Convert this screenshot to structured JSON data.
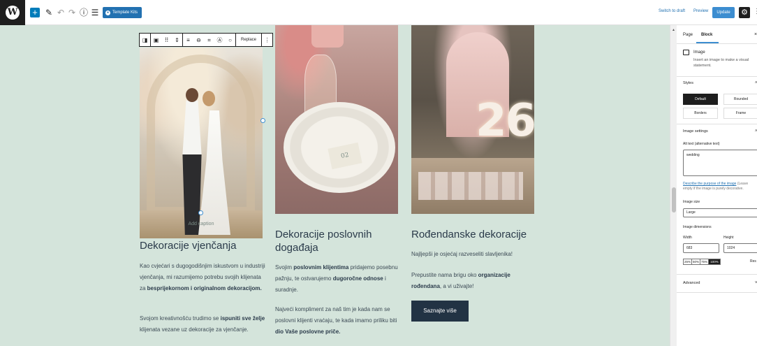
{
  "toolbar": {
    "template_kits": "Template Kits",
    "switch_to_draft": "Switch to draft",
    "preview": "Preview",
    "update": "Update"
  },
  "block_toolbar": {
    "replace": "Replace"
  },
  "canvas": {
    "caption_placeholder": "Add caption",
    "photo2_card_text": "02",
    "photo3_number": "26",
    "columns": [
      {
        "heading": "Dekoracije vjenčanja",
        "p1_a": "Kao cvjećari s dugogodišnjim iskustvom u industriji vjenčanja, mi razumijemo potrebu svojih klijenata za ",
        "p1_b": "besprijekornom i originalnom dekoracijom.",
        "p2_a": "Svojom kreativnošću trudimo se ",
        "p2_b": "ispuniti sve želje",
        "p2_c": " klijenata vezane uz dekoracije za vjenčanje."
      },
      {
        "heading": "Dekoracije poslovnih događaja",
        "p1_a": "Svojim ",
        "p1_b": "poslovnim klijentima",
        "p1_c": " pridajemo posebnu pažnju, te ostvarujemo ",
        "p1_d": "dugoročne odnose",
        "p1_e": " i suradnje.",
        "p2_a": "Najveći kompliment za naš tim je kada nam se poslovni klijenti vraćaju, te kada imamo priliku biti ",
        "p2_b": "dio Vaše poslovne priče."
      },
      {
        "heading": "Rođendanske dekoracije",
        "p1": "Najljepši je osjećaj razveseliti slavljenika!",
        "p2_a": "Prepustite nama brigu oko ",
        "p2_b": "organizacije rođendana",
        "p2_c": ", a vi uživajte!",
        "button": "Saznajte više"
      }
    ]
  },
  "sidebar": {
    "tabs": [
      "Page",
      "Block"
    ],
    "block_title": "Image",
    "block_desc": "Insert an image to make a visual statement.",
    "styles_title": "Styles",
    "style_options": [
      "Default",
      "Rounded",
      "Borders",
      "Frame"
    ],
    "image_settings_title": "Image settings",
    "alt_label": "Alt text (alternative text)",
    "alt_value": "wedding",
    "alt_help_link": "Describe the purpose of the image",
    "alt_help_rest": "(Leave empty if the image is purely decorative.",
    "image_size_label": "Image size",
    "image_size_value": "Large",
    "dimensions_label": "Image dimensions",
    "width_label": "Width",
    "height_label": "Height",
    "width_value": "683",
    "height_value": "1024",
    "percent_options": [
      "25%",
      "50%",
      "75%",
      "100%"
    ],
    "reset": "Res",
    "advanced_title": "Advanced"
  }
}
